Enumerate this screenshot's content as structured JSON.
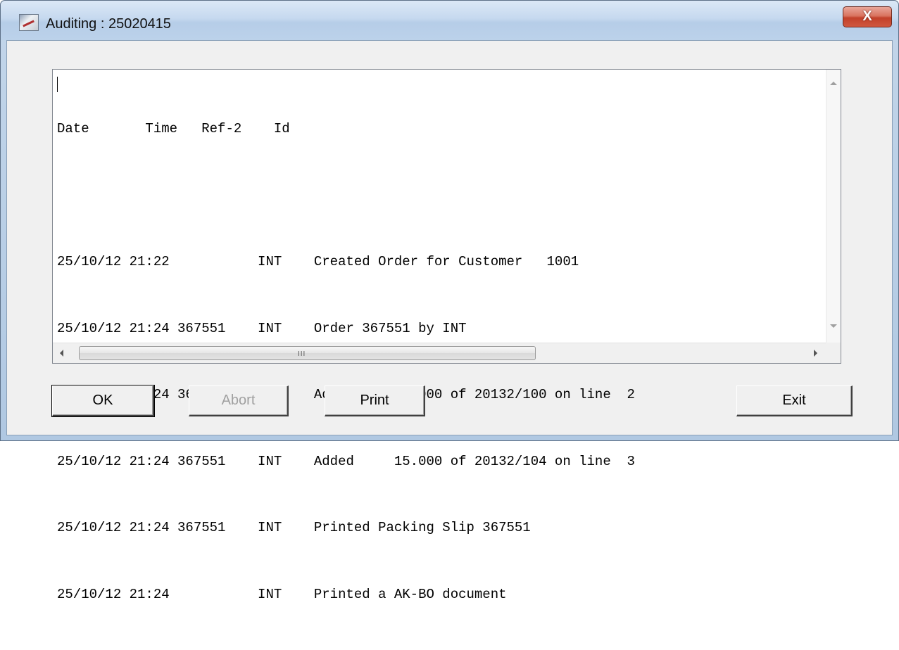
{
  "window": {
    "title": "Auditing : 25020415",
    "close_label": "X"
  },
  "list": {
    "lines": [
      "Date       Time   Ref-2    Id",
      "",
      "25/10/12 21:22           INT    Created Order for Customer   1001",
      "25/10/12 21:24 367551    INT    Order 367551 by INT",
      "25/10/12 21:24 367551    INT    Added     15.000 of 20132/100 on line  2",
      "25/10/12 21:24 367551    INT    Added     15.000 of 20132/104 on line  3",
      "25/10/12 21:24 367551    INT    Printed Packing Slip 367551",
      "25/10/12 21:24           INT    Printed a AK-BO document"
    ],
    "scroll_grip": "III"
  },
  "buttons": {
    "ok": "OK",
    "abort": "Abort",
    "print": "Print",
    "exit": "Exit"
  }
}
